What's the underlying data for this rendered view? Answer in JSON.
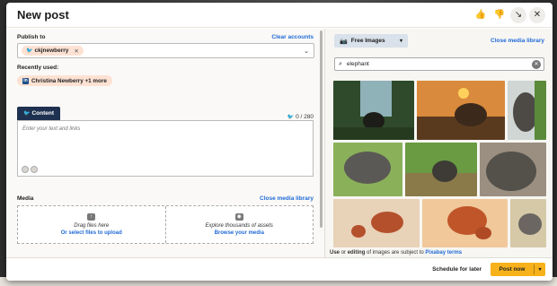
{
  "modal": {
    "title": "New post",
    "header_icons": [
      "thumbs-up-icon",
      "thumbs-down-icon",
      "minimize-icon",
      "close-icon"
    ]
  },
  "publish": {
    "label": "Publish to",
    "clear_label": "Clear accounts",
    "account": "ckjnewberry"
  },
  "recent": {
    "label": "Recently used:",
    "chip": "Christina Newberry  +1 more"
  },
  "content": {
    "tab_label": "Content",
    "counter": "0 / 280",
    "placeholder": "Enter your text and links"
  },
  "media": {
    "label": "Media",
    "close_label": "Close media library",
    "drag_text": "Drag files here",
    "upload_link": "Or select files to upload",
    "explore_text": "Explore thousands of assets",
    "browse_link": "Browse your media"
  },
  "library": {
    "source": "Free Images",
    "close_label": "Close media library",
    "search_value": "elephant",
    "terms_pre": "Use",
    "terms_or": "or",
    "terms_editing": "editing",
    "terms_mid": "of images are subject to",
    "terms_link": "Pixabay terms"
  },
  "footer": {
    "schedule_label": "Schedule for later",
    "post_label": "Post now"
  },
  "colors": {
    "accent": "#1f6ad6",
    "tab": "#1f3150",
    "chip": "#fde2d3",
    "post_button": "#f7b21b"
  }
}
